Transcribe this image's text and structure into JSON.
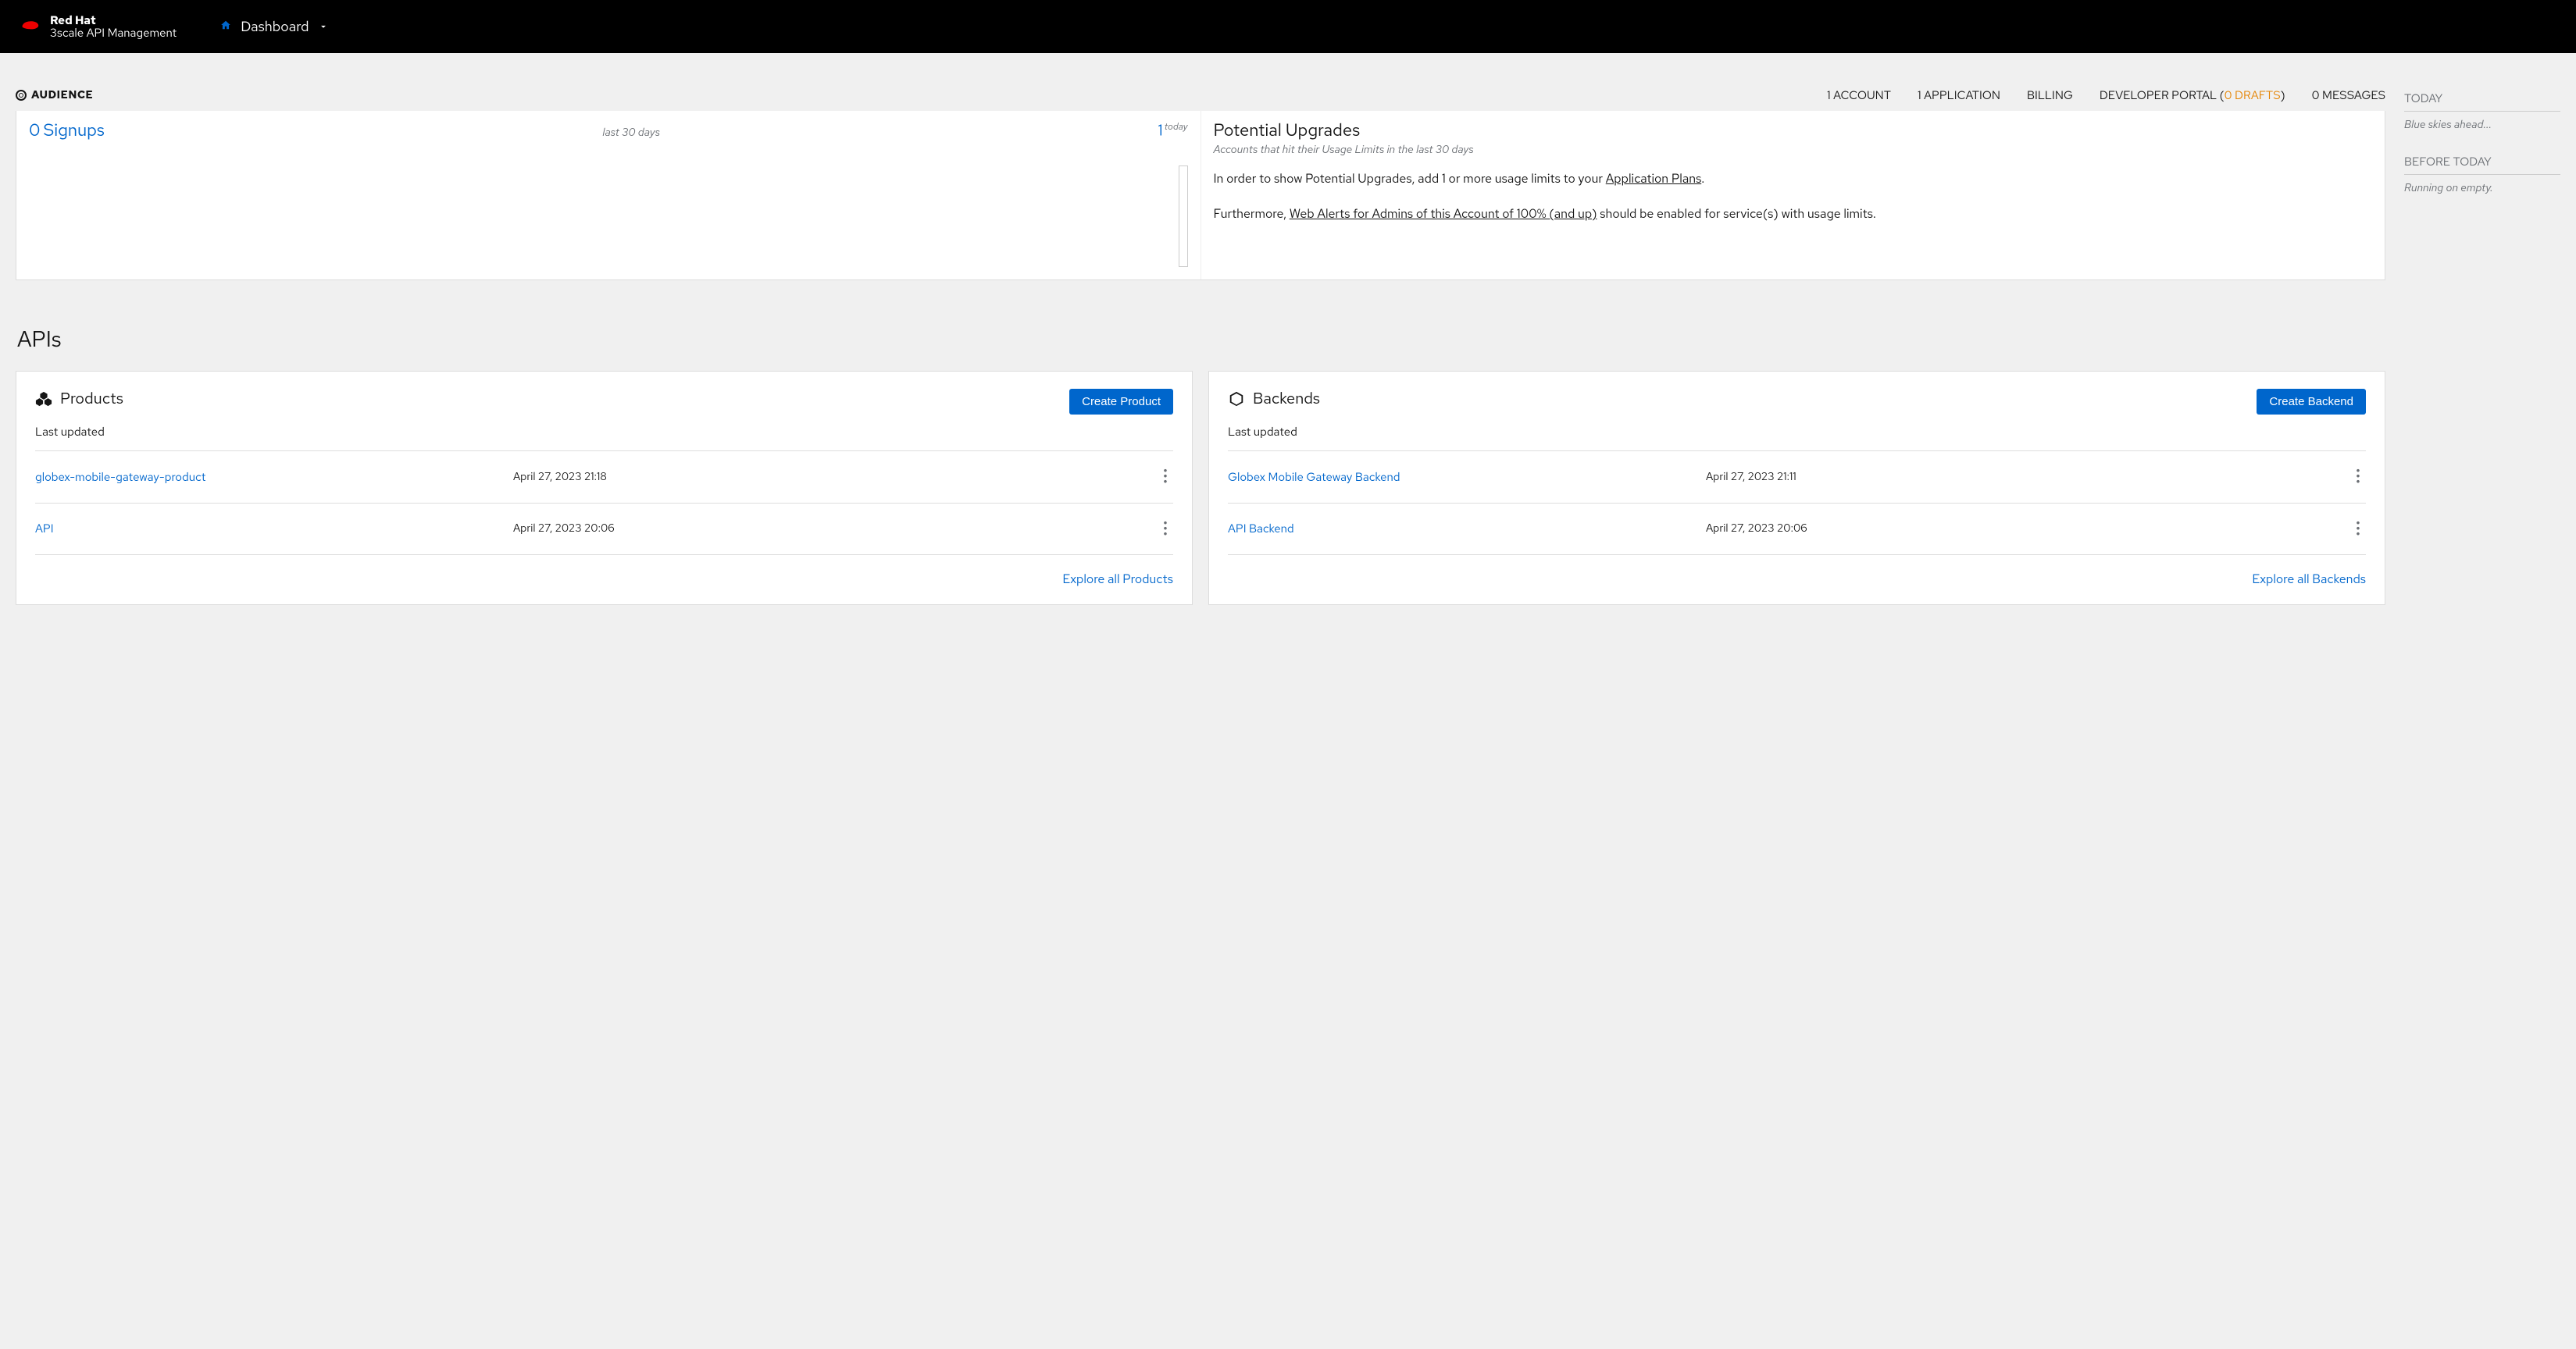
{
  "brand": {
    "top": "Red Hat",
    "bottom": "3scale API Management"
  },
  "context": "Dashboard",
  "audience": {
    "label": "AUDIENCE",
    "nav": {
      "accounts": "1 ACCOUNT",
      "applications": "1 APPLICATION",
      "billing": "BILLING",
      "devportal_prefix": "DEVELOPER PORTAL (",
      "devportal_drafts": "0 DRAFTS",
      "devportal_suffix": ")",
      "messages": "0 MESSAGES"
    }
  },
  "signups": {
    "count": "0",
    "label": "Signups",
    "range": "last 30 days",
    "today_count": "1",
    "today_label": "today"
  },
  "upgrades": {
    "title": "Potential Upgrades",
    "subtitle": "Accounts that hit their Usage Limits in the last 30 days",
    "p1_a": "In order to show Potential Upgrades, add 1 or more usage limits to your ",
    "p1_link": "Application Plans",
    "p1_b": ".",
    "p2_a": "Furthermore, ",
    "p2_link": "Web Alerts for Admins of this Account of 100% (and up)",
    "p2_b": " should be enabled for service(s) with usage limits."
  },
  "apis_heading": "APIs",
  "products": {
    "title": "Products",
    "create": "Create Product",
    "last_updated": "Last updated",
    "rows": [
      {
        "name": "globex-mobile-gateway-product",
        "ts": "April 27, 2023 21:18"
      },
      {
        "name": "API",
        "ts": "April 27, 2023 20:06"
      }
    ],
    "explore": "Explore all Products"
  },
  "backends": {
    "title": "Backends",
    "create": "Create Backend",
    "last_updated": "Last updated",
    "rows": [
      {
        "name": "Globex Mobile Gateway Backend",
        "ts": "April 27, 2023 21:11"
      },
      {
        "name": "API Backend",
        "ts": "April 27, 2023 20:06"
      }
    ],
    "explore": "Explore all Backends"
  },
  "sidebar": {
    "today": "TODAY",
    "today_msg": "Blue skies ahead...",
    "before": "BEFORE TODAY",
    "before_msg": "Running on empty."
  }
}
